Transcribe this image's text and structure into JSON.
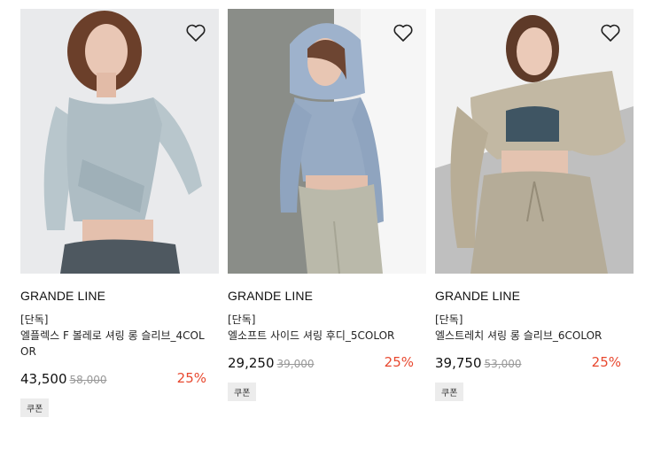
{
  "products": [
    {
      "image": "model in light blue bolero wrap long sleeve top and grey leggings",
      "wishlist_icon": "heart-outline-icon",
      "brand": "GRANDE LINE",
      "tag": "[단독]",
      "name": "엘플렉스 F 볼레로 셔링 롱 슬리브_4COLOR",
      "price": "43,500",
      "original_price": "58,000",
      "discount": "25%",
      "coupon": "쿠폰"
    },
    {
      "image": "model in blue hooded shirring long sleeve top and khaki leggings",
      "wishlist_icon": "heart-outline-icon",
      "brand": "GRANDE LINE",
      "tag": "[단독]",
      "name": "엘소프트 사이드 셔링 후디_5COLOR",
      "price": "29,250",
      "original_price": "39,000",
      "discount": "25%",
      "coupon": "쿠폰"
    },
    {
      "image": "model in beige shirring long sleeve sweatshirt and jogger pants",
      "wishlist_icon": "heart-outline-icon",
      "brand": "GRANDE LINE",
      "tag": "[단독]",
      "name": "엘스트레치 셔링 롱 슬리브_6COLOR",
      "price": "39,750",
      "original_price": "53,000",
      "discount": "25%",
      "coupon": "쿠폰"
    }
  ],
  "colors": {
    "discount": "#e8482f",
    "coupon_bg": "#ececec"
  }
}
